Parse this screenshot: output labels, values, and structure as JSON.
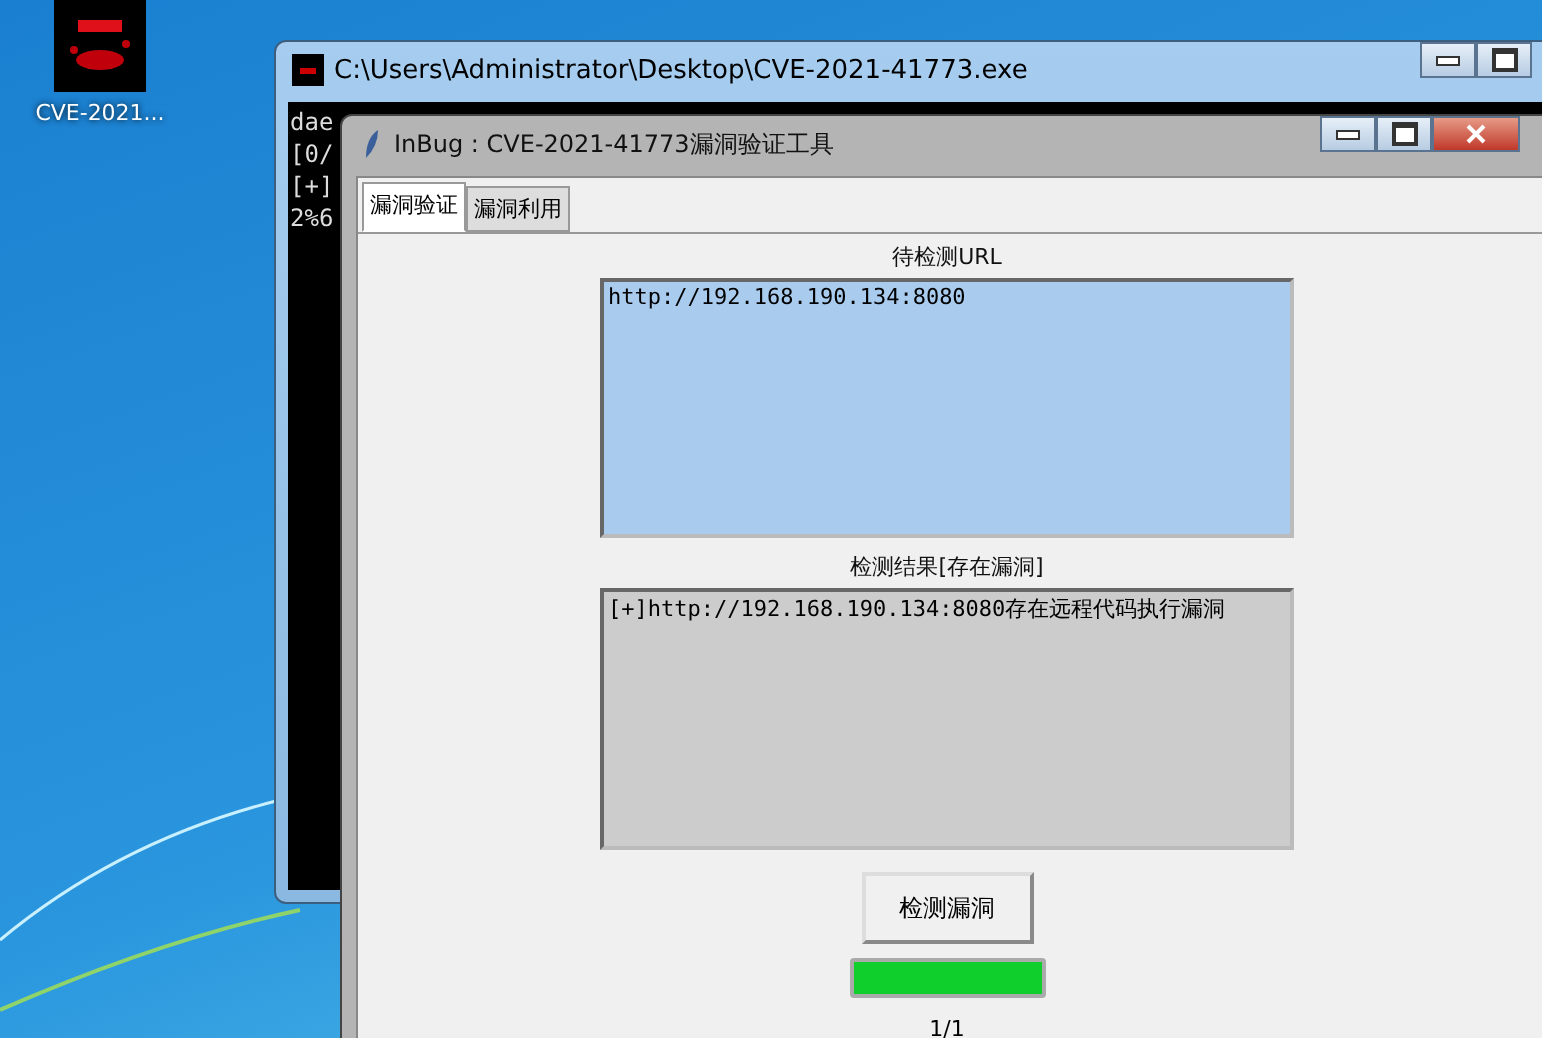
{
  "desktop_icon": {
    "label": "CVE-2021..."
  },
  "console_window": {
    "title": "C:\\Users\\Administrator\\Desktop\\CVE-2021-41773.exe",
    "lines": [
      "dae",
      "[0/",
      "[+]",
      "2%6"
    ]
  },
  "tool_window": {
    "title": "InBug : CVE-2021-41773漏洞验证工具",
    "tabs": [
      {
        "label": "漏洞验证",
        "selected": true
      },
      {
        "label": "漏洞利用",
        "selected": false
      }
    ],
    "url_label": "待检测URL",
    "url_value": "http://192.168.190.134:8080",
    "result_label": "检测结果[存在漏洞]",
    "result_value": "[+]http://192.168.190.134:8080存在远程代码执行漏洞",
    "button": "检测漏洞",
    "progress": {
      "level": 1
    },
    "progress_text": "1/1"
  }
}
